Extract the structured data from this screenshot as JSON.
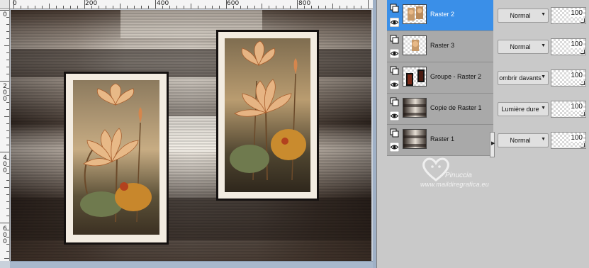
{
  "rulers": {
    "top_labels": [
      "0",
      "200",
      "400",
      "600",
      "800"
    ],
    "left_labels": [
      "0",
      "2\n0\n0",
      "4\n0\n0",
      "6\n0\n0"
    ]
  },
  "layers": [
    {
      "name": "Raster 2",
      "blend": "Normal",
      "opacity": "100",
      "selected": true,
      "thumb": "flowers-transparent"
    },
    {
      "name": "Raster 3",
      "blend": "Normal",
      "opacity": "100",
      "selected": false,
      "thumb": "flowers-transparent-small"
    },
    {
      "name": "Groupe - Raster 2",
      "blend": "ombrir davants",
      "opacity": "100",
      "selected": false,
      "thumb": "dark-frames"
    },
    {
      "name": "Copie de Raster 1",
      "blend": "Lumière dure",
      "opacity": "100",
      "selected": false,
      "thumb": "brown-background"
    },
    {
      "name": "Raster 1",
      "blend": "Normal",
      "opacity": "100",
      "selected": false,
      "thumb": "brown-background"
    }
  ],
  "watermark": {
    "line1": "Pinuccia",
    "line2": "www.maildiregrafica.eu"
  },
  "icons": {
    "visibility": "eye-icon",
    "layer_type": "raster-layer-icon",
    "dropdown": "chevron-down-icon"
  },
  "colors": {
    "selected_row": "#3a8fe8",
    "canvas_bg": "#3d3029",
    "mat": "#f3ece1"
  }
}
